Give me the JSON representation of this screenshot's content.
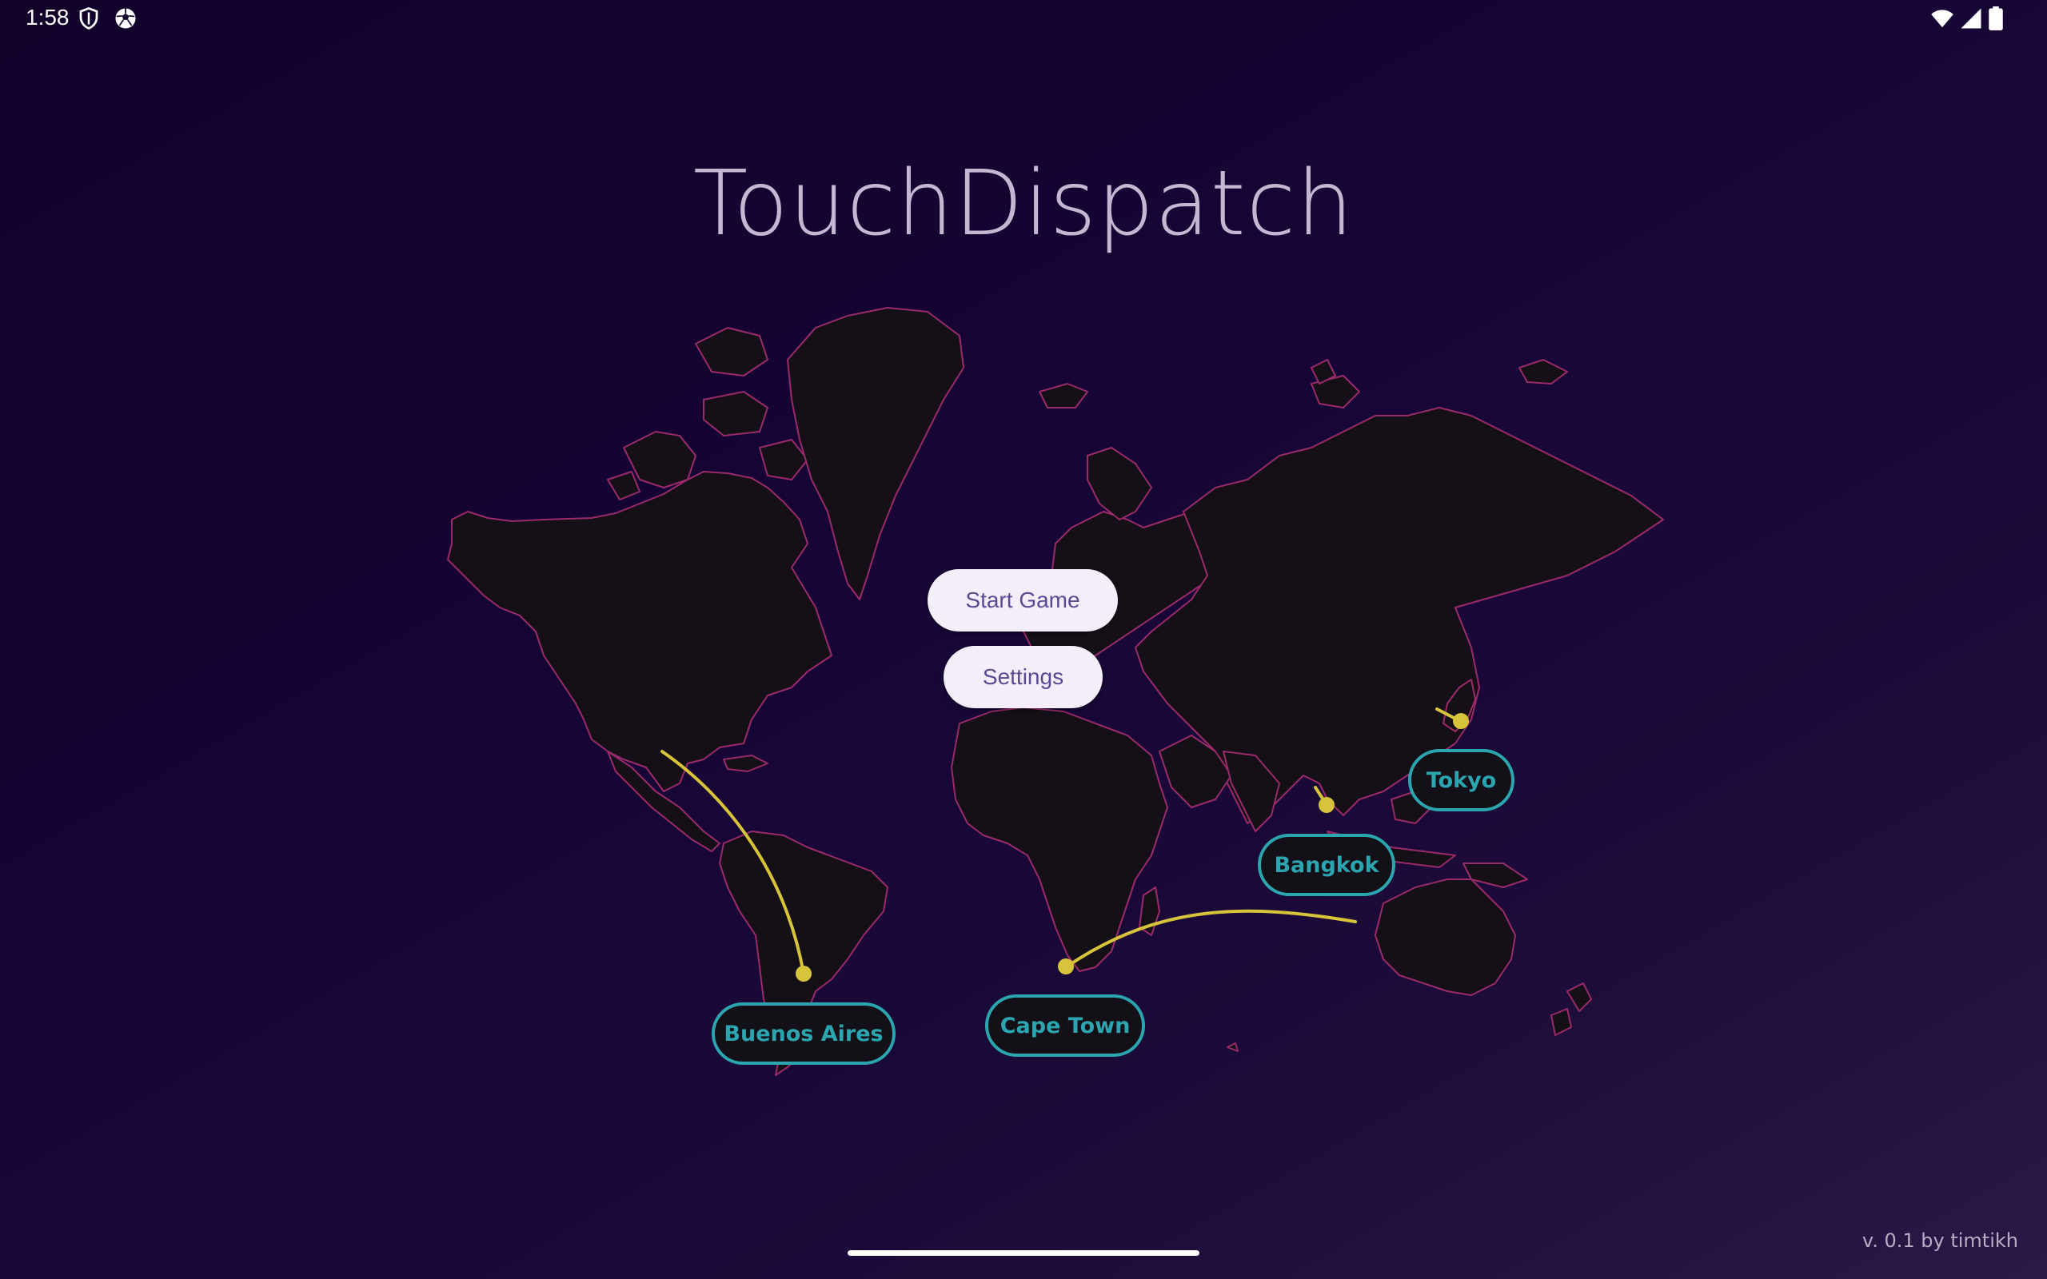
{
  "status_bar": {
    "time": "1:58",
    "icons": [
      "shield-icon",
      "soccer-ball-icon",
      "wifi-icon",
      "cell-signal-icon",
      "battery-icon"
    ]
  },
  "title": "TouchDispatch",
  "menu": {
    "start_label": "Start Game",
    "settings_label": "Settings"
  },
  "cities": [
    {
      "name": "Buenos Aires"
    },
    {
      "name": "Cape Town"
    },
    {
      "name": "Bangkok"
    },
    {
      "name": "Tokyo"
    }
  ],
  "version": "v. 0.1 by timtikh",
  "colors": {
    "accent_teal": "#2ba6b0",
    "route_yellow": "#d8c43a",
    "border_magenta": "#9a2a6a",
    "land": "#151018",
    "button_bg": "#f3eefa",
    "button_text": "#5b4a93",
    "title": "#c4b7d2"
  }
}
